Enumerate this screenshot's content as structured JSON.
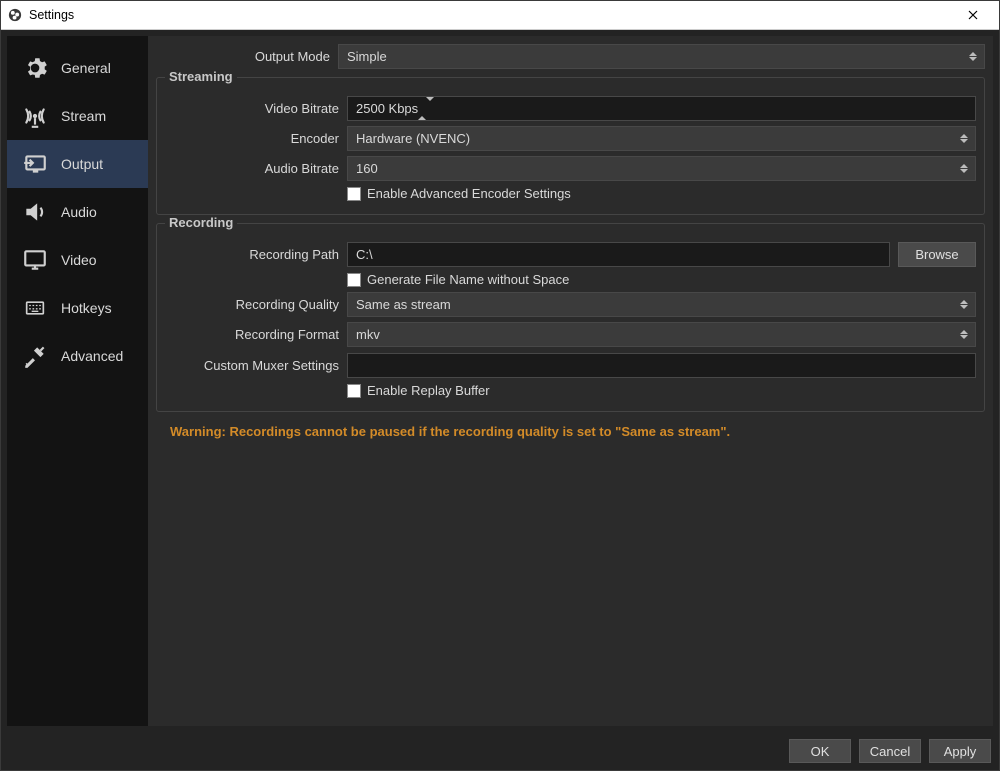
{
  "window": {
    "title": "Settings"
  },
  "sidebar": {
    "items": [
      {
        "key": "general",
        "label": "General"
      },
      {
        "key": "stream",
        "label": "Stream"
      },
      {
        "key": "output",
        "label": "Output"
      },
      {
        "key": "audio",
        "label": "Audio"
      },
      {
        "key": "video",
        "label": "Video"
      },
      {
        "key": "hotkeys",
        "label": "Hotkeys"
      },
      {
        "key": "advanced",
        "label": "Advanced"
      }
    ],
    "active": "output"
  },
  "top": {
    "output_mode_label": "Output Mode",
    "output_mode_value": "Simple"
  },
  "streaming": {
    "legend": "Streaming",
    "video_bitrate_label": "Video Bitrate",
    "video_bitrate_value": "2500 Kbps",
    "encoder_label": "Encoder",
    "encoder_value": "Hardware (NVENC)",
    "audio_bitrate_label": "Audio Bitrate",
    "audio_bitrate_value": "160",
    "enable_adv_label": "Enable Advanced Encoder Settings"
  },
  "recording": {
    "legend": "Recording",
    "path_label": "Recording Path",
    "path_value": "C:\\",
    "browse_label": "Browse",
    "gen_filename_label": "Generate File Name without Space",
    "quality_label": "Recording Quality",
    "quality_value": "Same as stream",
    "format_label": "Recording Format",
    "format_value": "mkv",
    "muxer_label": "Custom Muxer Settings",
    "muxer_value": "",
    "enable_replay_label": "Enable Replay Buffer"
  },
  "warning_text": "Warning: Recordings cannot be paused if the recording quality is set to \"Same as stream\".",
  "footer": {
    "ok": "OK",
    "cancel": "Cancel",
    "apply": "Apply"
  }
}
